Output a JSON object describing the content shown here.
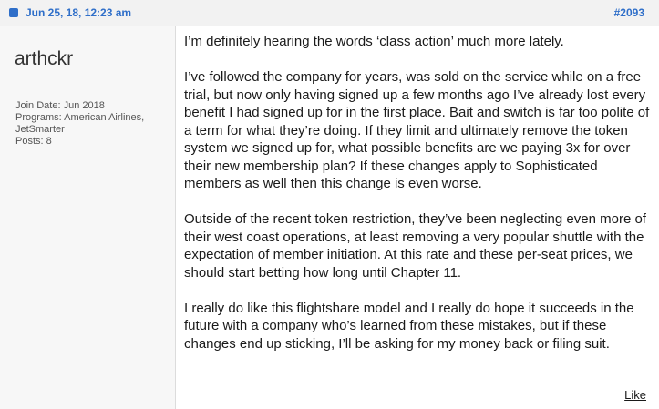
{
  "header": {
    "date": "Jun 25, 18, 12:23 am",
    "post_number": "#2093",
    "icon": "post-icon",
    "accent_color": "#2f6fc9"
  },
  "user": {
    "name": "arthckr",
    "join_date": "Join Date: Jun 2018",
    "programs_line1": "Programs: American Airlines,",
    "programs_line2": "JetSmarter",
    "posts": "Posts: 8"
  },
  "post": {
    "paragraphs": [
      "I’m definitely hearing the words ‘class action’ much more lately.",
      "I’ve followed the company for years, was sold on the service while on a free trial, but now only having signed up a few months ago I’ve already lost every benefit I had signed up for in the first place. Bait and switch is far too polite of a term for what they’re doing. If they limit and ultimately remove the token system we signed up for, what possible benefits are we paying 3x for over their new membership plan? If these changes apply to Sophisticated members as well then this change is even worse.",
      "Outside of the recent token restriction, they’ve been neglecting even more of their west coast operations, at least removing a very popular shuttle with the expectation of member initiation. At this rate and these per-seat prices, we should start betting how long until Chapter 11.",
      "I really do like this flightshare model and I really do hope it succeeds in the future with a company who’s learned from these mistakes, but if these changes end up sticking, I’ll be asking for my money back or filing suit."
    ]
  },
  "actions": {
    "like_label": "Like"
  }
}
